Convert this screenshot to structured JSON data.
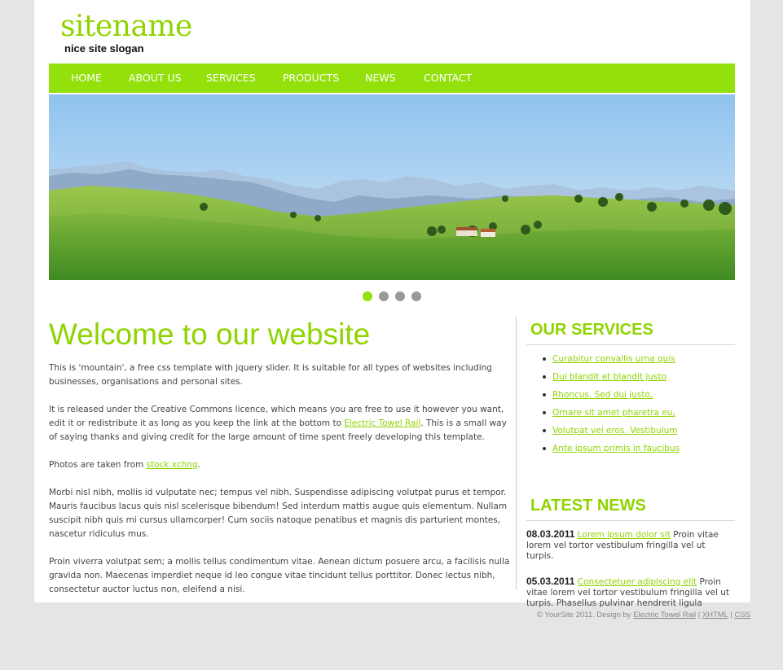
{
  "header": {
    "site_name": "sitename",
    "slogan": "nice site slogan"
  },
  "nav": {
    "items": [
      {
        "label": "HOME"
      },
      {
        "label": "ABOUT US"
      },
      {
        "label": "SERVICES"
      },
      {
        "label": "PRODUCTS"
      },
      {
        "label": "NEWS"
      },
      {
        "label": "CONTACT"
      }
    ]
  },
  "slider": {
    "slide_count": 4,
    "active_index": 0
  },
  "colors": {
    "accent": "#93e00b",
    "background": "#e5e5e5",
    "text": "#444444"
  },
  "main": {
    "title": "Welcome to our website",
    "p1": "This is 'mountain', a free css template with jquery slider. It is suitable for all types of websites including businesses, organisations and personal sites.",
    "p2_a": "It is released under the Creative Commons licence, which means you are free to use it however you want, edit it or redistribute it as long as you keep the link at the bottom to ",
    "p2_link": "Electric Towel Rail",
    "p2_b": ". This is a small way of saying thanks and giving credit for the large amount of time spent freely developing this template.",
    "p3_a": "Photos are taken from ",
    "p3_link": "stock.xchng",
    "p3_b": ".",
    "p4": "Morbi nisl nibh, mollis id vulputate nec; tempus vel nibh. Suspendisse adipiscing volutpat purus et tempor. Mauris faucibus lacus quis nisl scelerisque bibendum! Sed interdum mattis augue quis elementum. Nullam suscipit nibh quis mi cursus ullamcorper! Cum sociis natoque penatibus et magnis dis parturient montes, nascetur ridiculus mus.",
    "p5": "Proin viverra volutpat sem; a mollis tellus condimentum vitae. Aenean dictum posuere arcu, a facilisis nulla gravida non. Maecenas imperdiet neque id leo congue vitae tincidunt tellus porttitor. Donec lectus nibh, consectetur auctor luctus non, eleifend a nisi."
  },
  "sidebar": {
    "services_title": "OUR SERVICES",
    "services": [
      "Curabitur convallis urna quis",
      "Dui blandit et blandit justo",
      "Rhoncus. Sed dui justo,",
      "Ornare sit amet pharetra eu,",
      "Volutpat vel eros. Vestibulum",
      "Ante ipsum primis in faucibus"
    ],
    "news_title": "LATEST NEWS",
    "news": [
      {
        "date": "08.03.2011",
        "link": "Lorem ipsum dolor sit",
        "text": " Proin vitae lorem vel tortor vestibulum fringilla vel ut turpis."
      },
      {
        "date": "05.03.2011",
        "link": "Consectetuer adipiscing elit",
        "text": " Proin vitae lorem vel tortor vestibulum fringilla vel ut turpis. Phasellus pulvinar hendrerit ligula"
      }
    ]
  },
  "footer": {
    "copyright": "© YourSite 2011. Design by ",
    "design_link": "Electric Towel Rail",
    "sep": " | ",
    "xhtml": "XHTML",
    "css": "CSS"
  }
}
